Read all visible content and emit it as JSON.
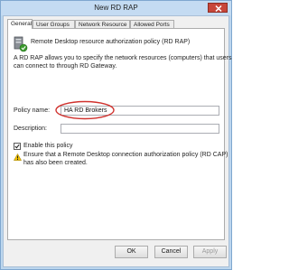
{
  "window": {
    "title": "New RD RAP"
  },
  "tabs": [
    {
      "label": "General"
    },
    {
      "label": "User Groups"
    },
    {
      "label": "Network Resource"
    },
    {
      "label": "Allowed Ports"
    }
  ],
  "general": {
    "header": "Remote Desktop resource authorization policy (RD RAP)",
    "description_line1": "A RD RAP allows you to specify the network resources (computers) that users",
    "description_line2": "can connect to through RD Gateway.",
    "policy_name_label": "Policy name:",
    "policy_name_value": "HA RD Brokers",
    "description_label": "Description:",
    "description_value": "",
    "enable_label": "Enable this policy",
    "enable_checked": true,
    "warning_line1": "Ensure that a Remote Desktop connection authorization policy (RD CAP)",
    "warning_line2": "has also been created."
  },
  "buttons": {
    "ok": "OK",
    "cancel": "Cancel",
    "apply": "Apply"
  },
  "colors": {
    "highlight_circle": "#d0312d",
    "warning_icon": "#f2c200"
  }
}
